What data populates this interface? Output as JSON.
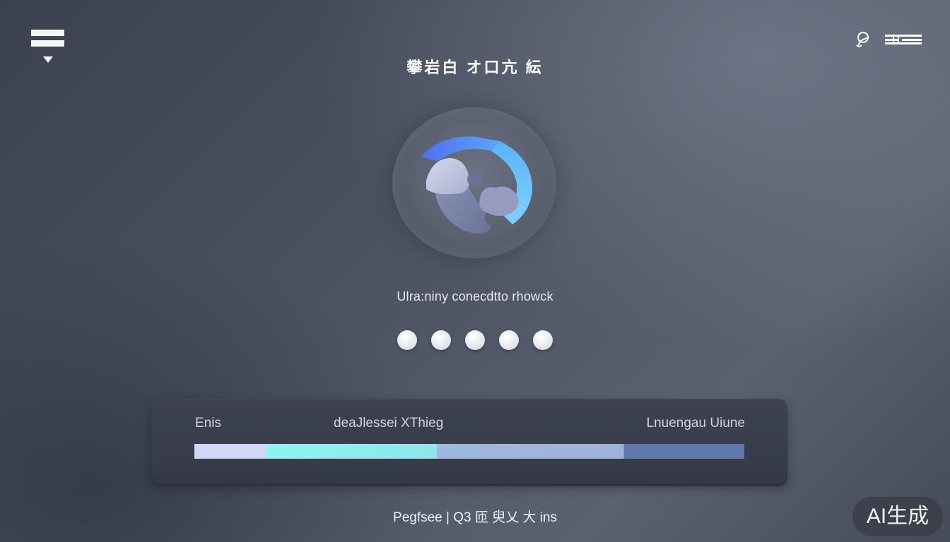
{
  "header": {
    "title": "攀岩白 オ口亢 紜"
  },
  "status": {
    "message": "Ulra:niny conecdtto rhowck"
  },
  "loading": {
    "dot_count": 5
  },
  "progress_panel": {
    "label_left": "Enis",
    "label_center": "deaJlessei XThieg",
    "label_right": "Lnuengau Uiune",
    "progress_fraction": 0.78,
    "segment_colors": [
      "#cfd9f3",
      "#8ff3f0",
      "#a0b2d8",
      "#5f77a9"
    ]
  },
  "footer": {
    "text": "Pegfsee | Q3 匝 臾乂 大 ins"
  },
  "badge": {
    "label": "AI生成"
  },
  "colors": {
    "background": "#4c5362",
    "accent_blue": "#5b9cf0",
    "accent_cyan": "#8ff3f0"
  },
  "icons": {
    "menu": "menu-icon",
    "account": "account-icon",
    "more": "more-icon",
    "logo": "app-logo-icon"
  }
}
